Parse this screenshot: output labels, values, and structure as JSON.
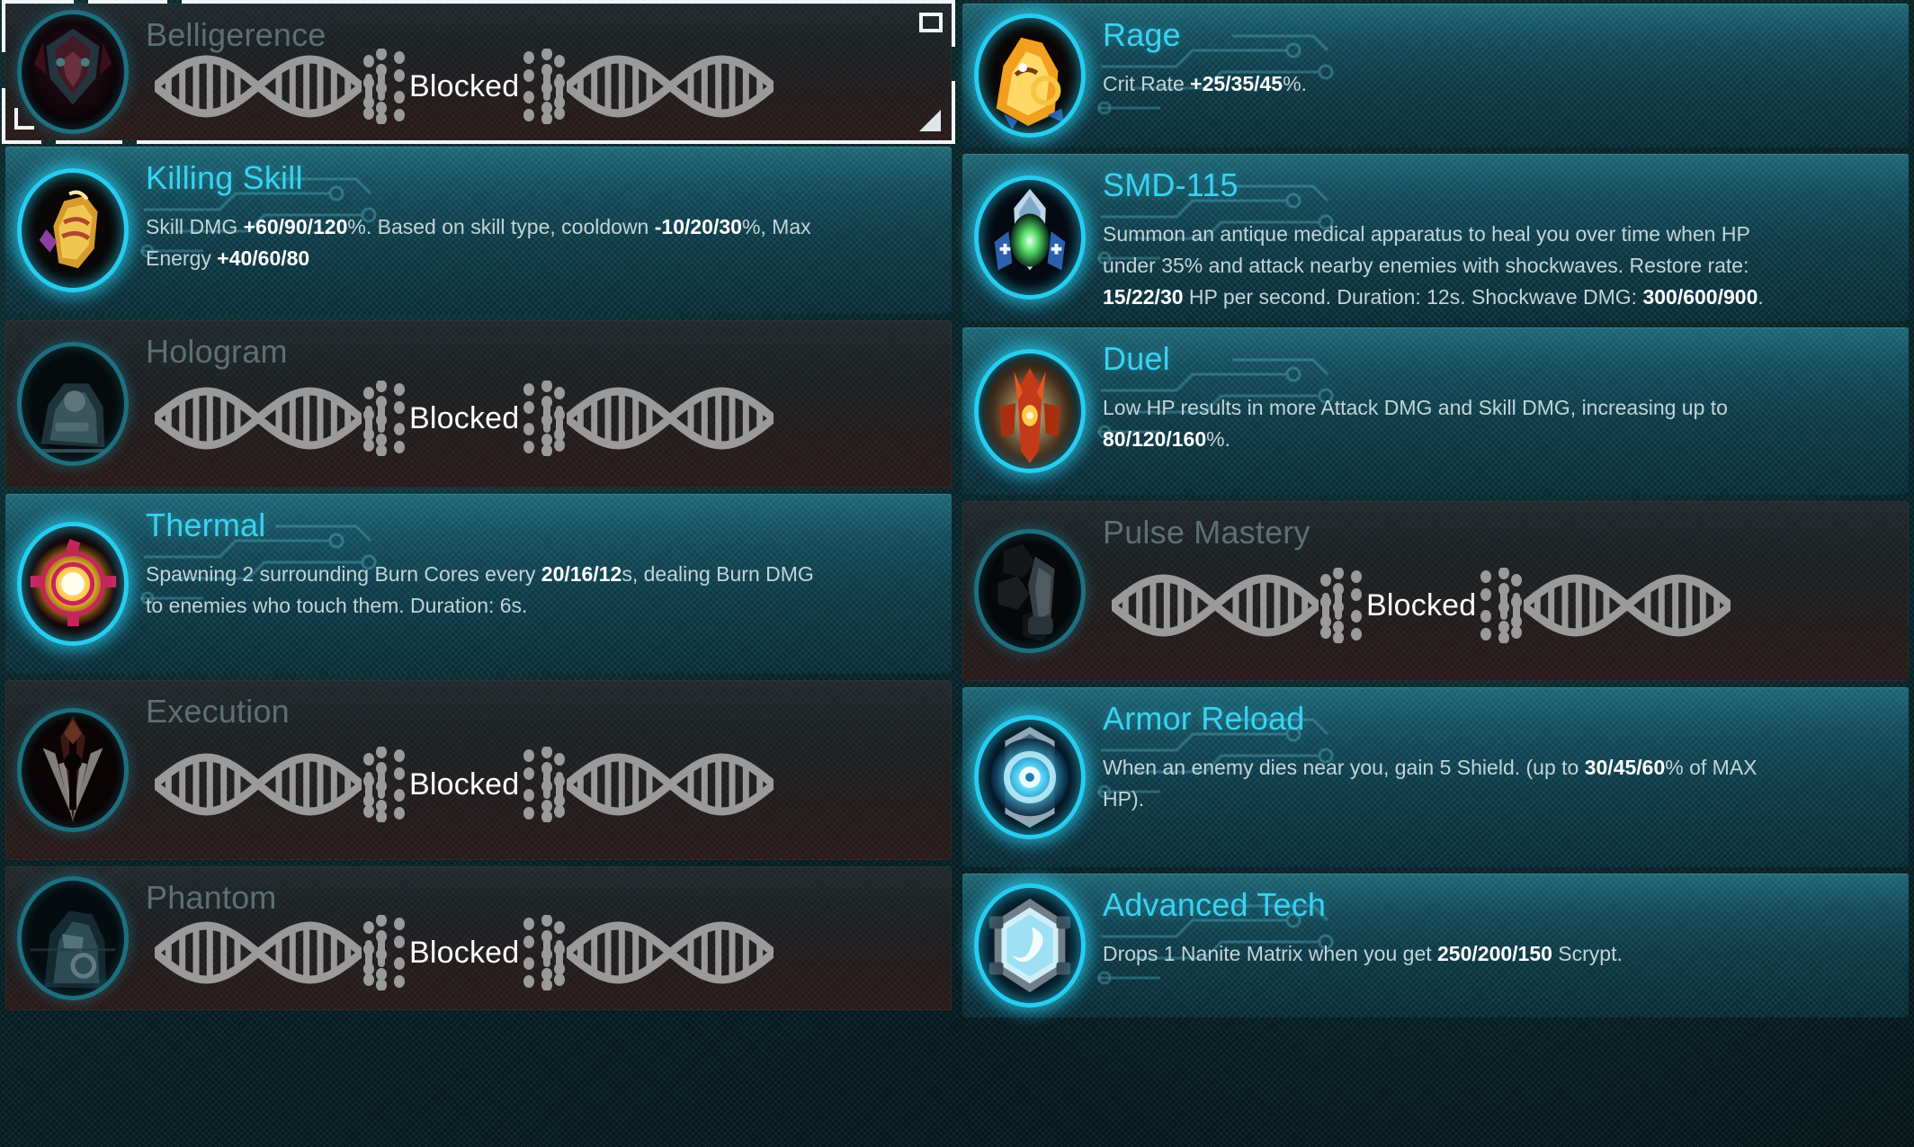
{
  "screen": {
    "name": "ability-chip-selection",
    "blocked_label": "Blocked",
    "accent_color": "#3ad2f0",
    "blocked_title_color": "#5d6f70",
    "highlight_color": "#ffffff"
  },
  "columns": [
    {
      "name": "left-column",
      "cards": [
        {
          "id": "belligerence",
          "title": "Belligerence",
          "state": "blocked",
          "selected": true,
          "icon": "belligerence-mask-icon",
          "status": "Blocked",
          "description": ""
        },
        {
          "id": "killing-skill",
          "title": "Killing Skill",
          "state": "active",
          "selected": false,
          "icon": "gauntlet-fist-icon",
          "status": "",
          "description": "Skill DMG +60/90/120%. Based on skill type, cooldown -10/20/30%, Max Energy +40/60/80",
          "highlights": [
            "+60/90/120",
            "-10/20/30",
            "+40/60/80"
          ]
        },
        {
          "id": "hologram",
          "title": "Hologram",
          "state": "blocked",
          "selected": false,
          "icon": "hologram-soldier-icon",
          "status": "Blocked",
          "description": ""
        },
        {
          "id": "thermal",
          "title": "Thermal",
          "state": "active",
          "selected": false,
          "icon": "thermal-burn-core-icon",
          "status": "",
          "description": "Spawning 2 surrounding Burn Cores every 20/16/12s, dealing Burn DMG to enemies who touch them. Duration: 6s.",
          "highlights": [
            "20/16/12"
          ]
        },
        {
          "id": "execution",
          "title": "Execution",
          "state": "blocked",
          "selected": false,
          "icon": "execution-sword-icon",
          "status": "Blocked",
          "description": ""
        },
        {
          "id": "phantom",
          "title": "Phantom",
          "state": "blocked",
          "selected": false,
          "icon": "phantom-armor-icon",
          "status": "Blocked",
          "description": ""
        }
      ]
    },
    {
      "name": "right-column",
      "cards": [
        {
          "id": "rage",
          "title": "Rage",
          "state": "active",
          "selected": false,
          "icon": "rage-flame-skull-icon",
          "status": "",
          "description": "Crit Rate +25/35/45%.",
          "highlights": [
            "+25/35/45"
          ]
        },
        {
          "id": "smd-115",
          "title": "SMD-115",
          "state": "active",
          "selected": false,
          "icon": "smd-medical-drone-icon",
          "status": "",
          "description": "Summon an antique medical apparatus to heal you over time when HP under 35% and attack nearby enemies with shockwaves. Restore rate: 15/22/30 HP per second. Duration: 12s. Shockwave DMG: 300/600/900.",
          "highlights": [
            "15/22/30",
            "300/600/900"
          ]
        },
        {
          "id": "duel",
          "title": "Duel",
          "state": "active",
          "selected": false,
          "icon": "duel-warrior-icon",
          "status": "",
          "description": "Low HP results in more Attack DMG and Skill DMG, increasing up to 80/120/160%.",
          "highlights": [
            "80/120/160"
          ]
        },
        {
          "id": "pulse-mastery",
          "title": "Pulse Mastery",
          "state": "blocked",
          "selected": false,
          "icon": "pulse-mastery-icon",
          "status": "Blocked",
          "description": ""
        },
        {
          "id": "armor-reload",
          "title": "Armor Reload",
          "state": "active",
          "selected": false,
          "icon": "armor-reload-shield-icon",
          "status": "",
          "description": "When an enemy dies near you, gain 5 Shield. (up to 30/45/60% of MAX HP).",
          "highlights": [
            "30/45/60"
          ]
        },
        {
          "id": "advanced-tech",
          "title": "Advanced Tech",
          "state": "active",
          "selected": false,
          "icon": "advanced-tech-crystal-icon",
          "status": "",
          "description": "Drops 1 Nanite Matrix when you get 250/200/150 Scrypt.",
          "highlights": [
            "250/200/150"
          ]
        }
      ]
    }
  ]
}
